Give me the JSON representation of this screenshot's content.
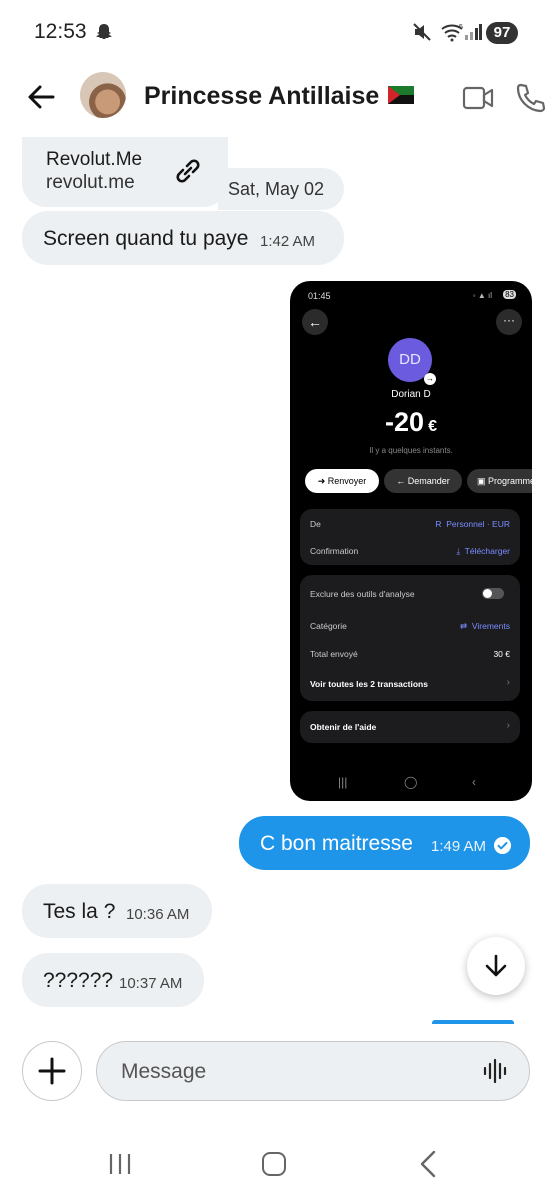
{
  "status_bar": {
    "time": "12:53",
    "battery": "97",
    "network": "5"
  },
  "header": {
    "contact_name": "Princesse Antillaise"
  },
  "messages": {
    "link_card": {
      "title": "Revolut.Me",
      "url": "revolut.me"
    },
    "date_separator": "Sat, May 02",
    "m1": {
      "text": "Screen quand tu paye",
      "time": "1:42 AM"
    },
    "m2": {
      "text": "C bon maitresse",
      "time": "1:49 AM"
    },
    "m3": {
      "text": "Tes la ?",
      "time": "10:36 AM"
    },
    "m4": {
      "text": "??????",
      "time": "10:37 AM"
    }
  },
  "screenshot": {
    "time": "01:45",
    "battery": "83",
    "avatar_initials": "DD",
    "name": "Dorian D",
    "amount": "-20",
    "currency": "€",
    "subtitle": "Il y a quelques instants.",
    "buttons": {
      "resend": "Renvoyer",
      "request": "Demander",
      "schedule": "Programmer"
    },
    "card1": {
      "from_label": "De",
      "from_value": "Personnel · EUR",
      "confirmation_label": "Confirmation",
      "confirmation_value": "Télécharger"
    },
    "card2": {
      "exclude_label": "Exclure des outils d'analyse",
      "category_label": "Catégorie",
      "category_value": "Virements",
      "total_label": "Total envoyé",
      "total_value": "30 €",
      "see_all": "Voir toutes les 2 transactions"
    },
    "help": "Obtenir de l'aide"
  },
  "composer": {
    "placeholder": "Message"
  },
  "colors": {
    "outgoing_bubble": "#1e95e8",
    "incoming_bubble": "#edf0f2",
    "revolut_accent": "#6b5bde"
  }
}
